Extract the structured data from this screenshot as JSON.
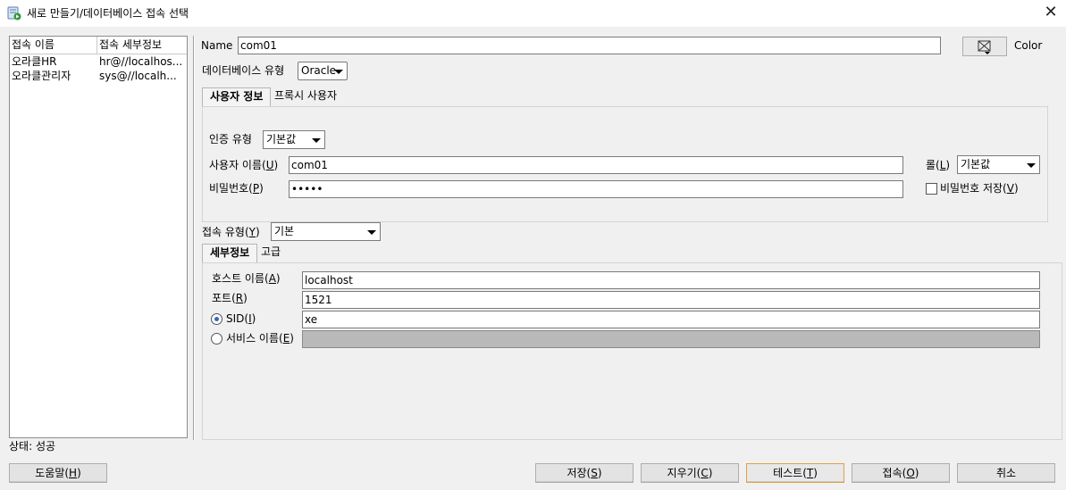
{
  "window": {
    "title": "새로 만들기/데이터베이스 접속 선택",
    "close_icon": "close-icon"
  },
  "connections": {
    "headers": [
      "접속 이름",
      "접속 세부정보"
    ],
    "rows": [
      {
        "name": "오라클HR",
        "detail": "hr@//localhos..."
      },
      {
        "name": "오라클관리자",
        "detail": "sys@//localh..."
      }
    ]
  },
  "form": {
    "name_label": "Name",
    "name_value": "com01",
    "color_label": "Color",
    "dbtype_label": "데이터베이스 유형",
    "dbtype_value": "Oracle",
    "tabs_top": [
      "사용자 정보",
      "프록시 사용자"
    ],
    "auth_label": "인증 유형",
    "auth_value": "기본값",
    "user_label_pre": "사용자 이름(",
    "user_label_key": "U",
    "user_label_post": ")",
    "user_value": "com01",
    "role_label_pre": "롤(",
    "role_label_key": "L",
    "role_label_post": ")",
    "role_value": "기본값",
    "pw_label_pre": "비밀번호(",
    "pw_label_key": "P",
    "pw_label_post": ")",
    "pw_value": "•••••",
    "savepw_pre": "비밀번호 저장(",
    "savepw_key": "V",
    "savepw_post": ")",
    "conntype_pre": "접속 유형(",
    "conntype_key": "Y",
    "conntype_post": ")",
    "conntype_value": "기본",
    "tabs_bottom": [
      "세부정보",
      "고급"
    ],
    "host_pre": "호스트 이름(",
    "host_key": "A",
    "host_post": ")",
    "host_value": "localhost",
    "port_pre": "포트(",
    "port_key": "R",
    "port_post": ")",
    "port_value": "1521",
    "sid_pre": "SID(",
    "sid_key": "I",
    "sid_post": ")",
    "sid_value": "xe",
    "svc_pre": "서비스 이름(",
    "svc_key": "E",
    "svc_post": ")",
    "svc_value": ""
  },
  "status": "상태: 성공",
  "buttons": {
    "help": {
      "pre": "도움말(",
      "key": "H",
      "post": ")"
    },
    "save": {
      "pre": "저장(",
      "key": "S",
      "post": ")"
    },
    "clear": {
      "pre": "지우기(",
      "key": "C",
      "post": ")"
    },
    "test": {
      "pre": "테스트(",
      "key": "T",
      "post": ")"
    },
    "connect": {
      "pre": "접속(",
      "key": "O",
      "post": ")"
    },
    "cancel": "취소"
  }
}
